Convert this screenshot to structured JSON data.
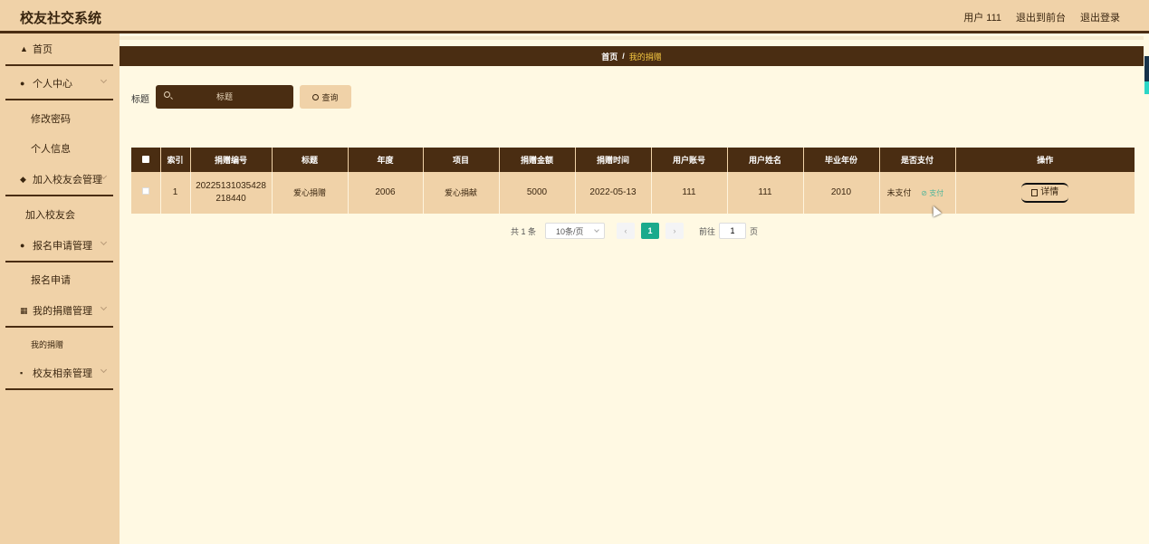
{
  "header": {
    "app_title": "校友社交系统",
    "user": "用户 111",
    "front_link": "退出到前台",
    "logout": "退出登录"
  },
  "sidebar": {
    "home": "首页",
    "personal_center": "个人中心",
    "change_password": "修改密码",
    "personal_info": "个人信息",
    "join_manage": "加入校友会管理",
    "join_club": "加入校友会",
    "signup_manage": "报名申请管理",
    "signup": "报名申请",
    "donation_manage": "我的捐赠管理",
    "my_donation": "我的捐赠",
    "dating_manage": "校友相亲管理"
  },
  "breadcrumb": {
    "home": "首页",
    "sep": "/",
    "current": "我的捐赠"
  },
  "search": {
    "label": "标题",
    "placeholder": "标题",
    "button": "查询"
  },
  "table": {
    "headers": [
      "索引",
      "捐赠编号",
      "标题",
      "年度",
      "项目",
      "捐赠金额",
      "捐赠时间",
      "用户账号",
      "用户姓名",
      "毕业年份",
      "是否支付",
      "操作"
    ],
    "rows": [
      {
        "index": "1",
        "donation_no_1": "20225131035428",
        "donation_no_2": "218440",
        "title": "爱心捐赠",
        "year": "2006",
        "project": "爱心捐献",
        "amount": "5000",
        "time": "2022-05-13",
        "account": "111",
        "name": "111",
        "grad_year": "2010",
        "paid_status": "未支付",
        "pay_link": "支付",
        "detail": "详情"
      }
    ]
  },
  "pagination": {
    "total": "共 1 条",
    "page_size": "10条/页",
    "prev": "‹",
    "current_page": "1",
    "next": "›",
    "goto_label": "前往",
    "goto_value": "1",
    "page_suffix": "页"
  }
}
